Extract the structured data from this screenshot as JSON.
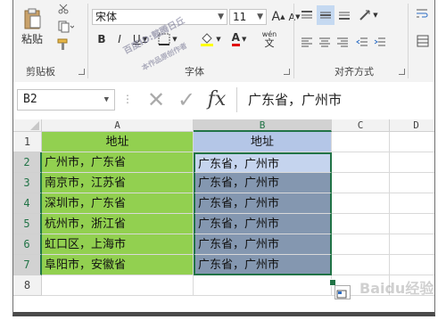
{
  "ribbon": {
    "paste_label": "粘贴",
    "clipboard_label": "剪贴板",
    "font_group_label": "字体",
    "align_group_label": "对齐方式",
    "font_name": "宋体",
    "font_size": "11",
    "bold": "B",
    "italic": "I",
    "underline": "U",
    "grow_font": "A",
    "shrink_font": "A",
    "phonetic": "wén",
    "phonetic2": "文"
  },
  "formula_bar": {
    "name_box": "B2",
    "fx": "fx",
    "content": "广东省，广州市"
  },
  "columns": [
    "A",
    "B",
    "C",
    "D"
  ],
  "rows": [
    {
      "num": "1",
      "a": "地址",
      "b": "地址"
    },
    {
      "num": "2",
      "a": "广州市，广东省",
      "b": "广东省，广州市"
    },
    {
      "num": "3",
      "a": "南京市，江苏省",
      "b": "广东省，广州市"
    },
    {
      "num": "4",
      "a": "深圳市，广东省",
      "b": "广东省，广州市"
    },
    {
      "num": "5",
      "a": "杭州市，浙江省",
      "b": "广东省，广州市"
    },
    {
      "num": "6",
      "a": "虹口区，上海市",
      "b": "广东省，广州市"
    },
    {
      "num": "7",
      "a": "阜阳市，安徽省",
      "b": "广东省，广州市"
    },
    {
      "num": "8",
      "a": "",
      "b": ""
    }
  ],
  "colors": {
    "green_fill": "#92d050",
    "blue_header": "#b4c6e7",
    "selection": "#8497b0",
    "selection_first": "#c5d4ee"
  }
}
